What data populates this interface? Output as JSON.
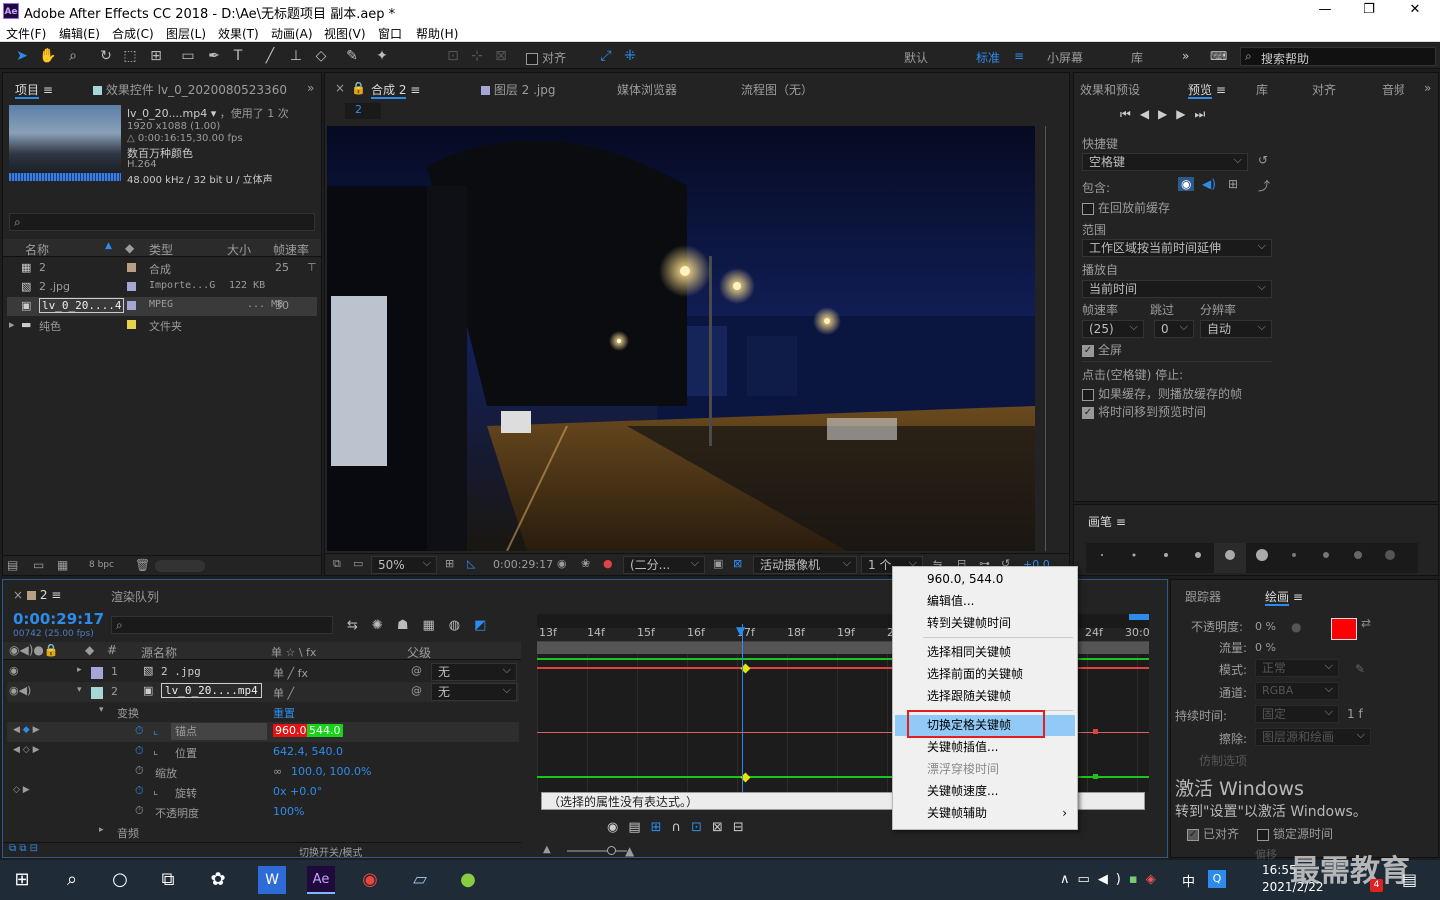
{
  "window": {
    "title": "Adobe After Effects CC 2018 - D:\\Ae\\无标题项目 副本.aep *",
    "app_icon": "Ae"
  },
  "menubar": [
    "文件(F)",
    "编辑(E)",
    "合成(C)",
    "图层(L)",
    "效果(T)",
    "动画(A)",
    "视图(V)",
    "窗口",
    "帮助(H)"
  ],
  "toolbar": {
    "snap_label": "对齐",
    "workspaces": [
      "默认",
      "标准",
      "小屏幕",
      "库"
    ],
    "search_placeholder": "搜索帮助"
  },
  "project_panel": {
    "tab_project": "项目",
    "tab_effects": "效果控件 lv_0_2020080523360",
    "item_name": "lv_0_20....mp4",
    "used": "，使用了 1 次",
    "resolution": "1920 x1088 (1.00)",
    "duration": "△ 0:00:16:15,30.00 fps",
    "colors": "数百万种颜色",
    "codec": "H.264",
    "audio": "48.000 kHz / 32 bit U / 立体声",
    "columns": [
      "名称",
      "类型",
      "大小",
      "帧速率"
    ],
    "rows": [
      {
        "name": "2",
        "type": "合成",
        "size": "",
        "fps": "25",
        "color": "#b5a084"
      },
      {
        "name": "2 .jpg",
        "type": "Importe...G",
        "size": "122 KB",
        "fps": "",
        "color": "#a6a6d6"
      },
      {
        "name": "lv_0_20....4",
        "type": "MPEG",
        "size": "... MB",
        "fps": "30",
        "color": "#a6a6d6"
      },
      {
        "name": "纯色",
        "type": "文件夹",
        "size": "",
        "fps": "",
        "color": "#e6d34d"
      }
    ],
    "bpc": "8 bpc"
  },
  "comp_panel": {
    "tab_comp": "合成 2",
    "tab_layer": "图层 2 .jpg",
    "tab_media": "媒体浏览器",
    "tab_flow": "流程图（无）",
    "breadcrumb": "2",
    "zoom": "50%",
    "timecode": "0:00:29:17",
    "resolution": "(二分...",
    "camera": "活动摄像机",
    "views": "1 个...",
    "exposure": "+0.0"
  },
  "preview_panel": {
    "tabs": [
      "效果和预设",
      "预览",
      "库",
      "对齐",
      "音频"
    ],
    "shortcut_label": "快捷键",
    "shortcut_value": "空格键",
    "include_label": "包含:",
    "cache_label": "在回放前缓存",
    "range_label": "范围",
    "range_value": "工作区域按当前时间延伸",
    "play_from_label": "播放自",
    "play_from_value": "当前时间",
    "fps_label": "帧速率",
    "skip_label": "跳过",
    "res_label": "分辨率",
    "fps_value": "(25)",
    "skip_value": "0",
    "res_value": "自动",
    "fullscreen_label": "全屏",
    "stop_label": "点击(空格键) 停止:",
    "stop_opt1": "如果缓存，则播放缓存的帧",
    "stop_opt2": "将时间移到预览时间"
  },
  "brush_panel": {
    "title": "画笔"
  },
  "timeline": {
    "tab": "2",
    "render_tab": "渲染队列",
    "timecode": "0:00:29:17",
    "frame_info": "00742 (25.00 fps)",
    "col_source": "源名称",
    "col_switch": "单 ☆ \\ fx",
    "col_parent": "父级",
    "layers": [
      {
        "num": "1",
        "name": "2 .jpg",
        "parent": "无"
      },
      {
        "num": "2",
        "name": "lv_0_20....mp4",
        "parent": "无"
      }
    ],
    "transform_label": "变换",
    "reset_label": "重置",
    "props": [
      {
        "name": "锚点",
        "value_x": "960.0",
        "value_y": "544.0"
      },
      {
        "name": "位置",
        "value": "642.4, 540.0"
      },
      {
        "name": "缩放",
        "value": "100.0, 100.0%"
      },
      {
        "name": "旋转",
        "value": "0x +0.0°"
      },
      {
        "name": "不透明度",
        "value": "100%"
      }
    ],
    "audio_label": "音频",
    "switch_mode": "切换开关/模式",
    "ruler": [
      "13f",
      "14f",
      "15f",
      "16f",
      "17f",
      "18f",
      "19f",
      "20f",
      "24f",
      "30:0"
    ],
    "expression_text": "（选择的属性没有表达式。）"
  },
  "context_menu": {
    "items": [
      {
        "label": "960.0, 544.0",
        "disabled": false,
        "highlight": false
      },
      {
        "label": "编辑值...",
        "disabled": false,
        "highlight": false
      },
      {
        "label": "转到关键帧时间",
        "disabled": false,
        "highlight": false
      },
      {
        "label": "选择相同关键帧",
        "disabled": false,
        "highlight": false
      },
      {
        "label": "选择前面的关键帧",
        "disabled": false,
        "highlight": false
      },
      {
        "label": "选择跟随关键帧",
        "disabled": false,
        "highlight": false
      },
      {
        "label": "切换定格关键帧",
        "disabled": false,
        "highlight": true
      },
      {
        "label": "关键帧插值...",
        "disabled": false,
        "highlight": false
      },
      {
        "label": "漂浮穿梭时间",
        "disabled": true,
        "highlight": false
      },
      {
        "label": "关键帧速度...",
        "disabled": false,
        "highlight": false
      },
      {
        "label": "关键帧辅助",
        "disabled": false,
        "highlight": false
      }
    ]
  },
  "right_bottom": {
    "tracker_tab": "跟踪器",
    "paint_tab": "绘画",
    "opacity_label": "不透明度:",
    "opacity_value": "0 %",
    "flow_label": "流量:",
    "flow_value": "0 %",
    "mode_label": "模式:",
    "mode_value": "正常",
    "channel_label": "通道:",
    "channel_value": "RGBA",
    "duration_label": "持续时间:",
    "duration_value": "固定",
    "erase_label": "擦除:",
    "erase_value": "图层源和绘画",
    "clone_label": "仿制选项",
    "activate_title": "激活 Windows",
    "activate_sub": "转到\"设置\"以激活 Windows。",
    "aligned_label": "已对齐",
    "lock_time_label": "锁定源时间",
    "offset_label": "偏移"
  },
  "taskbar": {
    "time": "16:55",
    "date": "2021/2/22",
    "ime": "中",
    "badge": "4",
    "watermark": "最需教育"
  }
}
